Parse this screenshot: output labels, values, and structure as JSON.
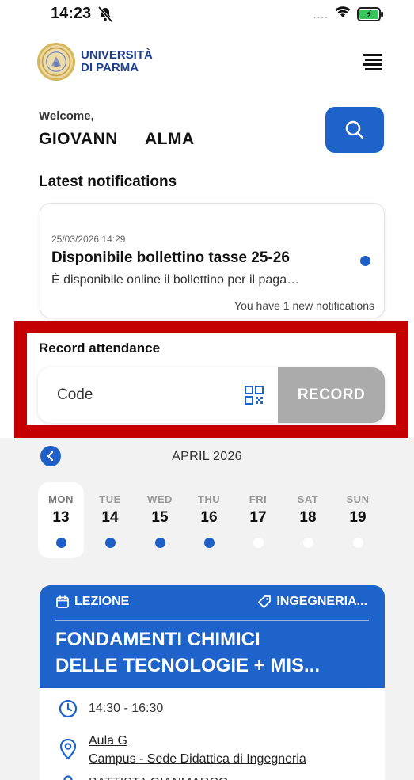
{
  "status_bar": {
    "time": "14:23",
    "dots": "....",
    "icons": [
      "silent-bell-icon",
      "wifi-icon",
      "battery-charging-icon"
    ],
    "battery_color": "#37c65c"
  },
  "header": {
    "logo_line1": "UNIVERSITÀ",
    "logo_line2": "DI PARMA",
    "brand_color": "#1d3f8f"
  },
  "welcome": {
    "label": "Welcome,",
    "first_name": "GIOVANN",
    "last_name": "ALMA"
  },
  "notifications": {
    "heading": "Latest notifications",
    "item": {
      "date": "25/03/2026 14:29",
      "title": "Disponibile bollettino tasse 25-26",
      "body": "È disponibile online il bollettino per il paga…",
      "unread": true
    },
    "count_text": "You have 1 new notifications"
  },
  "attendance": {
    "label": "Record attendance",
    "code_placeholder": "Code",
    "record_button": "RECORD"
  },
  "calendar": {
    "month": "APRIL 2026",
    "days": [
      {
        "name": "MON",
        "num": "13",
        "has_event": true,
        "selected": true
      },
      {
        "name": "TUE",
        "num": "14",
        "has_event": true,
        "selected": false
      },
      {
        "name": "WED",
        "num": "15",
        "has_event": true,
        "selected": false
      },
      {
        "name": "THU",
        "num": "16",
        "has_event": true,
        "selected": false
      },
      {
        "name": "FRI",
        "num": "17",
        "has_event": false,
        "selected": false
      },
      {
        "name": "SAT",
        "num": "18",
        "has_event": false,
        "selected": false
      },
      {
        "name": "SUN",
        "num": "19",
        "has_event": false,
        "selected": false
      }
    ]
  },
  "lesson": {
    "type": "LEZIONE",
    "department": "INGEGNERIA...",
    "title_line1": "FONDAMENTI CHIMICI",
    "title_line2": "DELLE TECNOLOGIE + MIS...",
    "time": "14:30 - 16:30",
    "room": "Aula G",
    "campus": "Campus - Sede Didattica di Ingegneria",
    "teacher": "BATTISTA GIANMARCO"
  },
  "colors": {
    "accent": "#1d63c9",
    "highlight": "#c40000",
    "record_disabled": "#ababab"
  }
}
